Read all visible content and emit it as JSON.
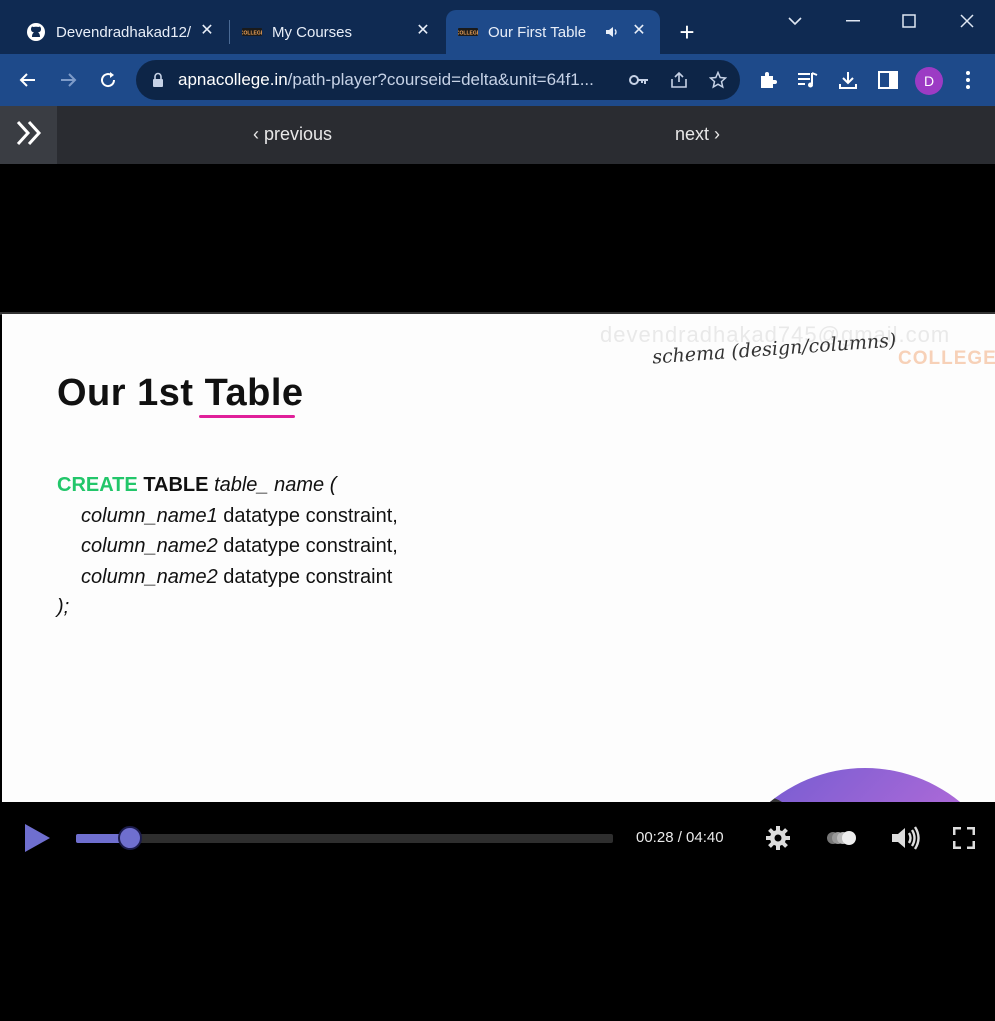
{
  "browser": {
    "tabs": [
      {
        "title": "Devendradhakad12/",
        "icon": "github-icon"
      },
      {
        "title": "My Courses",
        "icon": "apna-college-favicon"
      },
      {
        "title": "Our First Table",
        "icon": "apna-college-favicon",
        "audio": true,
        "active": true
      }
    ],
    "url_host": "apnacollege.in",
    "url_path": "/path-player?courseid=delta&unit=64f1...",
    "profile_initial": "D"
  },
  "course_nav": {
    "previous_label": "previous",
    "next_label": "next"
  },
  "slide": {
    "title": "Our 1st Table",
    "watermark": "devendradhakad745@gmail.com",
    "college_mark": "COLLEGE",
    "handwritten_note": "schema (design/columns)",
    "code": {
      "line1_kw1": "CREATE",
      "line1_kw2": "TABLE",
      "line1_rest": "table_ name (",
      "line2_name": "column_name1",
      "line2_rest": " datatype constraint,",
      "line3_name": "column_name2",
      "line3_rest": " datatype constraint,",
      "line4_name": "column_name2",
      "line4_rest": " datatype constraint",
      "line5": ");"
    }
  },
  "player": {
    "time": "00:28 / 04:40",
    "progress_fraction": 0.1
  },
  "colors": {
    "accent": "#6f6fcf",
    "create_keyword": "#22c66a",
    "title_underline": "#e0209a",
    "tab_strip": "#0f2a52",
    "toolbar": "#1e4a8a"
  }
}
